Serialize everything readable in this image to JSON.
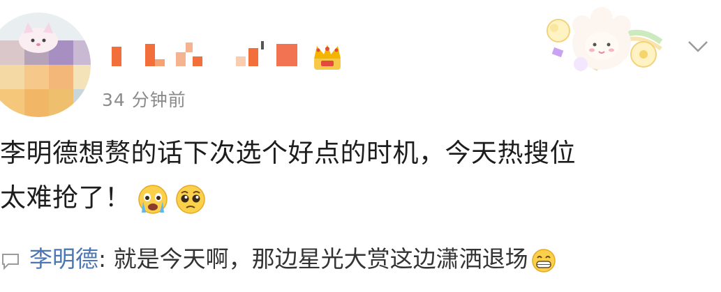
{
  "post": {
    "timestamp": "34 分钟前",
    "comment_line1": "李明德想赘的话下次选个好点的时机，今天热搜位",
    "comment_line2": "太难抢了！",
    "emojis": [
      "crying-face-icon",
      "pleading-face-icon"
    ]
  },
  "reply": {
    "user": "李明德",
    "colon": ":",
    "text": " 就是今天啊，那边星光大赏这边潇洒退场",
    "emoji": "grinning-face-icon"
  },
  "colors": {
    "link": "#4a77b3",
    "timestamp": "#8a8a8a",
    "text": "#1d1d1d"
  }
}
